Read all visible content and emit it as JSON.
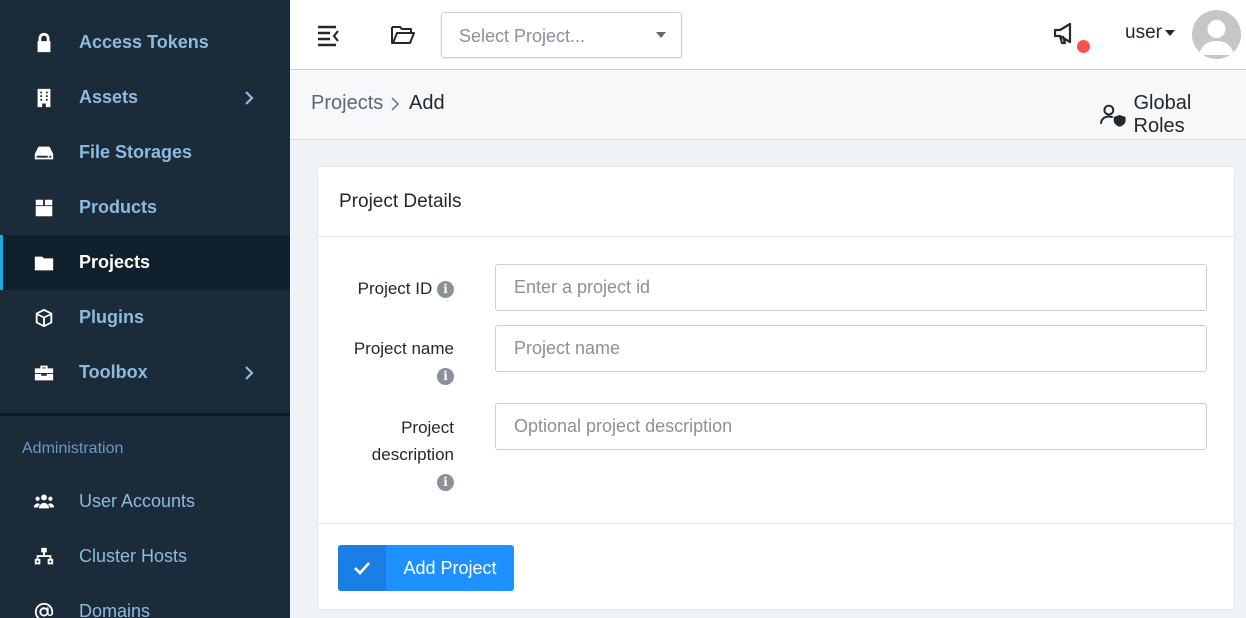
{
  "sidebar": {
    "items": [
      {
        "label": "Access Tokens",
        "icon": "lock-icon"
      },
      {
        "label": "Assets",
        "icon": "building-icon",
        "has_submenu": true
      },
      {
        "label": "File Storages",
        "icon": "hdd-icon"
      },
      {
        "label": "Products",
        "icon": "box-icon"
      },
      {
        "label": "Projects",
        "icon": "folder-icon",
        "active": true
      },
      {
        "label": "Plugins",
        "icon": "cube-icon"
      },
      {
        "label": "Toolbox",
        "icon": "toolbox-icon",
        "has_submenu": true
      }
    ],
    "admin_heading": "Administration",
    "admin_items": [
      {
        "label": "User Accounts",
        "icon": "users-icon"
      },
      {
        "label": "Cluster Hosts",
        "icon": "network-icon"
      },
      {
        "label": "Domains",
        "icon": "at-icon"
      }
    ]
  },
  "header": {
    "project_select_placeholder": "Select Project...",
    "user_label": "user",
    "notification_color": "#f4564d"
  },
  "breadcrumb": {
    "parent": "Projects",
    "current": "Add",
    "global_roles": "Global Roles"
  },
  "card": {
    "title": "Project Details",
    "fields": [
      {
        "label": "Project ID",
        "placeholder": "Enter a project id"
      },
      {
        "label": "Project name",
        "placeholder": "Project name"
      },
      {
        "label_line1": "Project",
        "label_line2": "description",
        "placeholder": "Optional project description"
      }
    ],
    "info_glyph": "i",
    "submit_label": "Add Project"
  },
  "colors": {
    "sidebar_bg": "#1b2b3a",
    "accent": "#1e90ff",
    "sidebar_text": "#8cbbe0"
  }
}
